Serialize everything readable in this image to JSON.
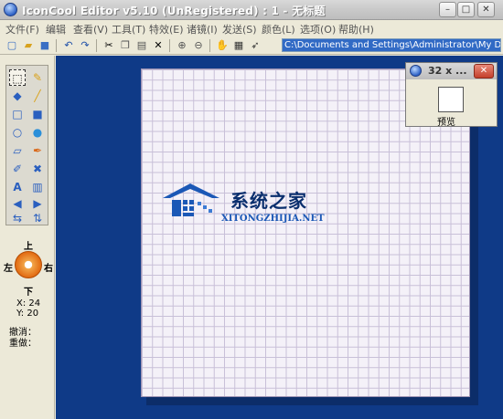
{
  "window": {
    "title": "IconCool Editor v5.10 (UnRegistered) : 1 - 无标题",
    "minimize": "–",
    "maximize": "□",
    "close": "✕"
  },
  "menu": [
    {
      "label": "文件(F)"
    },
    {
      "label": "编辑"
    },
    {
      "label": "查看(V)"
    },
    {
      "label": "工具(T)"
    },
    {
      "label": "特效(E)"
    },
    {
      "label": "诸镜(I)"
    },
    {
      "label": "发送(S)"
    },
    {
      "label": "颜色(L)"
    },
    {
      "label": "选项(O)"
    },
    {
      "label": "帮助(H)"
    }
  ],
  "toolbar": {
    "icons": [
      "new-icon",
      "open-icon",
      "save-icon",
      "undo-icon",
      "redo-icon",
      "cut-icon",
      "copy-icon",
      "paste-icon",
      "delete-icon",
      "zoom-in-icon",
      "zoom-out-icon",
      "hand-icon",
      "film-icon",
      "pointer-icon"
    ],
    "path": "C:\\Documents and Settings\\Administrator\\My Documents\\Upda"
  },
  "tools": [
    "select",
    "pencil",
    "fill",
    "brush",
    "rect-outline",
    "rect-filled",
    "ellipse-outline",
    "ellipse-filled",
    "eraser",
    "dropper",
    "pen",
    "crossed",
    "text",
    "gradient",
    "arrow-left",
    "arrow-right",
    "rotate",
    "flip"
  ],
  "dpad": {
    "up": "上",
    "down": "下",
    "left": "左",
    "right": "右"
  },
  "coords": {
    "x": "X: 24",
    "y": "Y: 20"
  },
  "history": {
    "undo": "撤消：",
    "redo": "重做："
  },
  "watermark": {
    "title": "系统之家",
    "url": "XITONGZHIJIA.NET"
  },
  "preview": {
    "title": "32 x ...",
    "label": "预览"
  }
}
